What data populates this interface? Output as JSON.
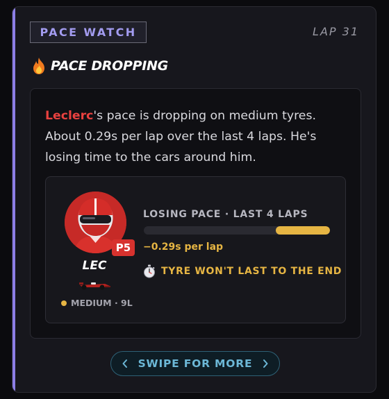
{
  "header": {
    "tag": "PACE WATCH",
    "lap": "LAP 31"
  },
  "alert": {
    "icon": "fire-icon",
    "title": "PACE DROPPING"
  },
  "description": {
    "driver": "Leclerc",
    "text": "'s pace is dropping on medium tyres. About 0.29s per lap over the last 4 laps. He's losing time to the cars around him."
  },
  "driver_card": {
    "code": "LEC",
    "position": "P5",
    "tyre": "MEDIUM · 9L",
    "team_color": "#c62a27",
    "tyre_color": "#e6b543"
  },
  "metric": {
    "label": "LOSING PACE · LAST 4 LAPS",
    "value": "−0.29s per lap",
    "bar_fraction": 0.29,
    "warning": "TYRE WON'T LAST TO THE END",
    "warning_icon": "stopwatch-icon"
  },
  "footer": {
    "swipe_label": "SWIPE FOR MORE"
  }
}
